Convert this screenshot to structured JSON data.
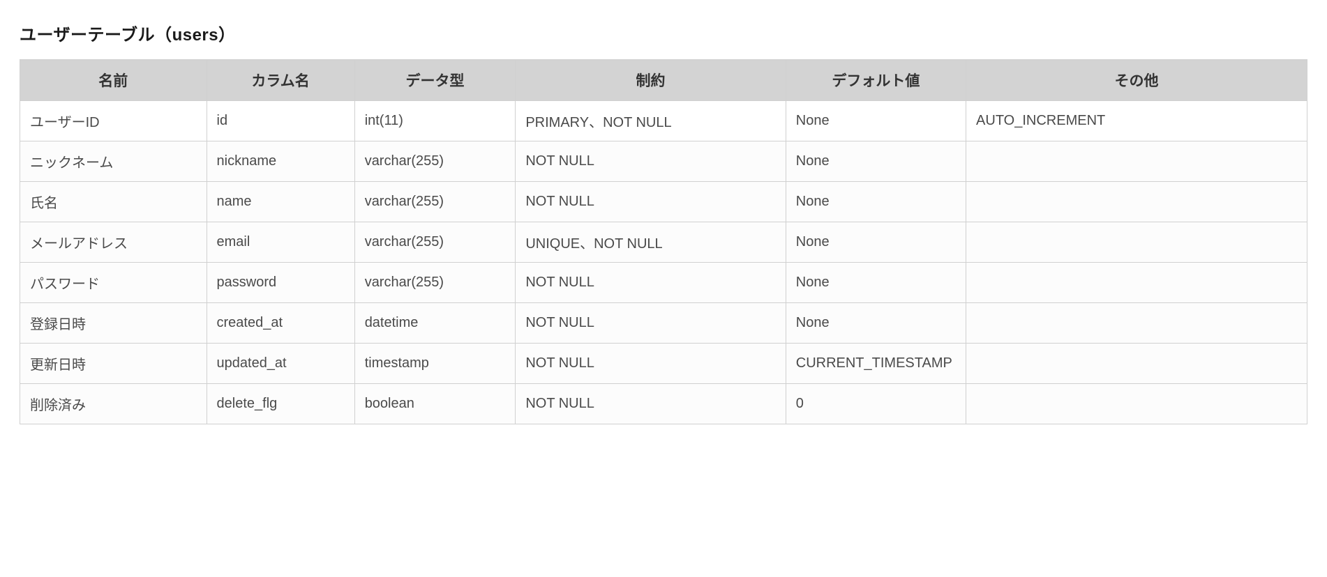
{
  "title": "ユーザーテーブル（users）",
  "headers": {
    "name": "名前",
    "column": "カラム名",
    "type": "データ型",
    "constraint": "制約",
    "default": "デフォルト値",
    "other": "その他"
  },
  "rows": [
    {
      "name": "ユーザーID",
      "column": "id",
      "type": "int(11)",
      "constraint": "PRIMARY、NOT NULL",
      "default": "None",
      "other": "AUTO_INCREMENT"
    },
    {
      "name": "ニックネーム",
      "column": "nickname",
      "type": "varchar(255)",
      "constraint": "NOT NULL",
      "default": "None",
      "other": ""
    },
    {
      "name": "氏名",
      "column": "name",
      "type": "varchar(255)",
      "constraint": "NOT NULL",
      "default": "None",
      "other": ""
    },
    {
      "name": "メールアドレス",
      "column": "email",
      "type": "varchar(255)",
      "constraint": "UNIQUE、NOT NULL",
      "default": "None",
      "other": ""
    },
    {
      "name": "パスワード",
      "column": "password",
      "type": "varchar(255)",
      "constraint": "NOT NULL",
      "default": "None",
      "other": ""
    },
    {
      "name": "登録日時",
      "column": "created_at",
      "type": "datetime",
      "constraint": "NOT NULL",
      "default": "None",
      "other": ""
    },
    {
      "name": "更新日時",
      "column": "updated_at",
      "type": "timestamp",
      "constraint": "NOT NULL",
      "default": "CURRENT_TIMESTAMP",
      "other": ""
    },
    {
      "name": "削除済み",
      "column": "delete_flg",
      "type": "boolean",
      "constraint": "NOT NULL",
      "default": "0",
      "other": ""
    }
  ]
}
